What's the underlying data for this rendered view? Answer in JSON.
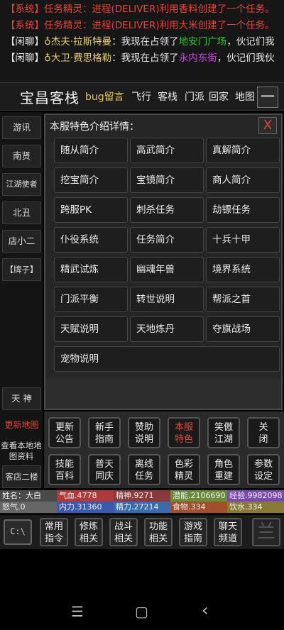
{
  "chat": {
    "line1": "【系统】任务精灵：进程(DELIVER)利用香料创建了一个任务。",
    "line2": "【系统】任务精灵：进程(DELIVER)利用大米创建了一个任务。",
    "line3": {
      "tag": "【闲聊】",
      "user": "♁杰夫·拉斯特曼",
      "text1": "：我现在占领了",
      "place": "地安门广场",
      "text2": "，伙记们我"
    },
    "line4": {
      "tag": "【闲聊】",
      "user": "♁大卫·费思格勒",
      "text1": "：我现在占领了",
      "place": "永内东街",
      "text2": "，伙记们我伙"
    }
  },
  "header": {
    "title": "宝昌客栈",
    "links": [
      "bug留言",
      "飞行",
      "客栈",
      "门派",
      "回家",
      "地图"
    ],
    "menu_label": "一"
  },
  "sidebar": {
    "items": [
      "游讯",
      "南贤",
      "江湖使者",
      "北丑",
      "店小二",
      "【牌子】",
      "天 神"
    ],
    "red_link": "更新地图",
    "info1": "查看本地地图资料",
    "info2": "客店二楼"
  },
  "panel": {
    "title": "本服特色介绍详情：",
    "close": "X",
    "topics": [
      "随从简介",
      "高武简介",
      "真解简介",
      "挖宝简介",
      "宝镜简介",
      "商人简介",
      "跨服PK",
      "刺杀任务",
      "劫镖任务",
      "仆役系统",
      "任务简介",
      "十兵十甲",
      "精武试炼",
      "幽魂年兽",
      "境界系统",
      "门派平衡",
      "转世说明",
      "帮派之首",
      "天赋说明",
      "天地炼丹",
      "夺旗战场",
      "宠物说明"
    ]
  },
  "functions": {
    "row1": [
      [
        "更新",
        "公告"
      ],
      [
        "新手",
        "指南"
      ],
      [
        "赞助",
        "说明"
      ],
      [
        "本服",
        "特色"
      ],
      [
        "笑傲",
        "江湖"
      ],
      [
        "关",
        "闭"
      ]
    ],
    "row2": [
      [
        "技能",
        "百科"
      ],
      [
        "普天",
        "同庆"
      ],
      [
        "离线",
        "任务"
      ],
      [
        "色彩",
        "精灵"
      ],
      [
        "角色",
        "重建"
      ],
      [
        "参数",
        "设定"
      ]
    ]
  },
  "stats": {
    "name": "姓名：大白",
    "qixue": "气血.4778",
    "jingshen": "精神.9271",
    "qianneng": "潜能.2106690",
    "jingyan": "经验.9982098",
    "nuqi": "怒气.0",
    "neili": "内力.31360",
    "jingli": "精力.27214",
    "shiwu": "食物.334",
    "yinshui": "饮水.334"
  },
  "commands": {
    "console": "C:\\",
    "items": [
      [
        "常用",
        "指令"
      ],
      [
        "修炼",
        "相关"
      ],
      [
        "战斗",
        "相关"
      ],
      [
        "功能",
        "相关"
      ],
      [
        "游戏",
        "指南"
      ],
      [
        "聊天",
        "频道"
      ]
    ],
    "extra": "兰"
  },
  "nav": {
    "menu": "☰",
    "home": "▢",
    "back": "‹"
  },
  "colors": {
    "system": "#e0453a",
    "user": "#e8d070",
    "place_green": "#31c23a",
    "place_purple": "#c24bd6",
    "highlight": "#e0453a"
  }
}
